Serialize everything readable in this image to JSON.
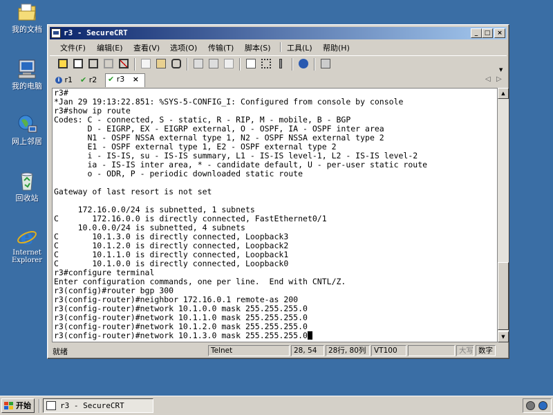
{
  "desktop": {
    "icons": [
      {
        "label": "我的文档",
        "icon": "my-documents-icon"
      },
      {
        "label": "我的电脑",
        "icon": "my-computer-icon"
      },
      {
        "label": "网上邻居",
        "icon": "network-places-icon"
      },
      {
        "label": "回收站",
        "icon": "recycle-bin-icon"
      },
      {
        "label_line1": "Internet",
        "label_line2": "Explorer",
        "icon": "internet-explorer-icon"
      }
    ]
  },
  "window": {
    "title": "r3 - SecureCRT",
    "controls": {
      "minimize": "_",
      "maximize": "□",
      "close": "×"
    }
  },
  "menu": [
    "文件(F)",
    "编辑(E)",
    "查看(V)",
    "选项(O)",
    "传输(T)",
    "脚本(S)",
    "工具(L)",
    "帮助(H)"
  ],
  "tabs": [
    {
      "label": "r1",
      "status": "info"
    },
    {
      "label": "r2",
      "status": "connected"
    },
    {
      "label": "r3",
      "status": "connected",
      "active": true,
      "close": "×"
    }
  ],
  "tab_nav": {
    "left": "◁",
    "right": "▷"
  },
  "terminal": {
    "lines": [
      "r3#",
      "*Jan 29 19:13:22.851: %SYS-5-CONFIG_I: Configured from console by console",
      "r3#show ip route",
      "Codes: C - connected, S - static, R - RIP, M - mobile, B - BGP",
      "       D - EIGRP, EX - EIGRP external, O - OSPF, IA - OSPF inter area",
      "       N1 - OSPF NSSA external type 1, N2 - OSPF NSSA external type 2",
      "       E1 - OSPF external type 1, E2 - OSPF external type 2",
      "       i - IS-IS, su - IS-IS summary, L1 - IS-IS level-1, L2 - IS-IS level-2",
      "       ia - IS-IS inter area, * - candidate default, U - per-user static route",
      "       o - ODR, P - periodic downloaded static route",
      "",
      "Gateway of last resort is not set",
      "",
      "     172.16.0.0/24 is subnetted, 1 subnets",
      "C       172.16.0.0 is directly connected, FastEthernet0/1",
      "     10.0.0.0/24 is subnetted, 4 subnets",
      "C       10.1.3.0 is directly connected, Loopback3",
      "C       10.1.2.0 is directly connected, Loopback2",
      "C       10.1.1.0 is directly connected, Loopback1",
      "C       10.1.0.0 is directly connected, Loopback0",
      "r3#configure terminal",
      "Enter configuration commands, one per line.  End with CNTL/Z.",
      "r3(config)#router bgp 300",
      "r3(config-router)#neighbor 172.16.0.1 remote-as 200",
      "r3(config-router)#network 10.1.0.0 mask 255.255.255.0",
      "r3(config-router)#network 10.1.1.0 mask 255.255.255.0",
      "r3(config-router)#network 10.1.2.0 mask 255.255.255.0",
      "r3(config-router)#network 10.1.3.0 mask 255.255.255.0"
    ]
  },
  "status": {
    "ready": "就绪",
    "protocol": "Telnet",
    "cursor_pos": "28, 54",
    "rows_cols": "28行, 80列",
    "emulation": "VT100",
    "caps": "大写",
    "num": "数字"
  },
  "taskbar": {
    "start": "开始",
    "task_label": "r3 - SecureCRT"
  }
}
